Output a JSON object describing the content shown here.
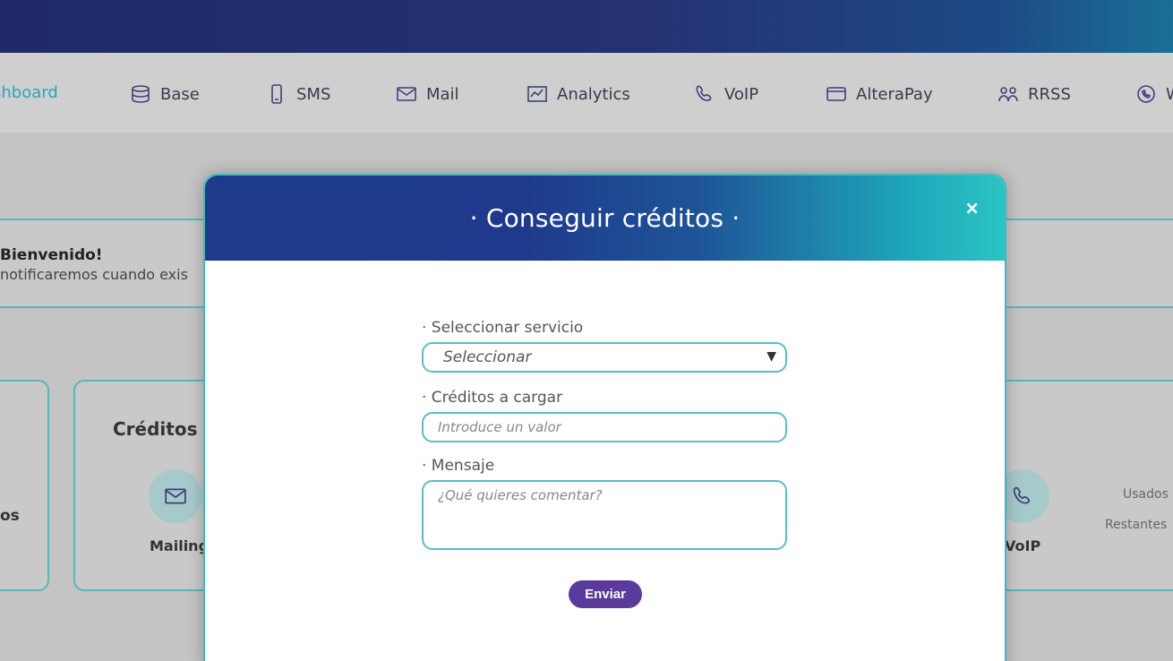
{
  "nav": {
    "items": [
      {
        "label": "shboard",
        "icon": "dashboard-icon",
        "active": true
      },
      {
        "label": "Base",
        "icon": "database-icon"
      },
      {
        "label": "SMS",
        "icon": "mobile-icon"
      },
      {
        "label": "Mail",
        "icon": "envelope-icon"
      },
      {
        "label": "Analytics",
        "icon": "chart-icon"
      },
      {
        "label": "VoIP",
        "icon": "phone-icon"
      },
      {
        "label": "AlteraPay",
        "icon": "card-icon"
      },
      {
        "label": "RRSS",
        "icon": "people-icon"
      },
      {
        "label": "W",
        "icon": "whatsapp-icon"
      }
    ]
  },
  "background": {
    "welcome_title": "Bienvenido!",
    "welcome_text": "notificaremos cuando exis",
    "cut_text": "os",
    "credits_title": "Créditos",
    "mailing_label": "Mailing",
    "voip_label": "VoIP",
    "used_label": "Usados",
    "remaining_label": "Restantes"
  },
  "modal": {
    "title": "· Conseguir créditos ·",
    "close_symbol": "×",
    "service_label": "· Seleccionar servicio",
    "service_value": "Seleccionar",
    "credits_label": "· Créditos a cargar",
    "credits_placeholder": "Introduce un valor",
    "message_label": "· Mensaje",
    "message_placeholder": "¿Qué quieres comentar?",
    "send_label": "Enviar"
  },
  "colors": {
    "accent": "#42b8c0",
    "button": "#5a3a9a",
    "header_start": "#1e3a8a",
    "header_end": "#2bc4c4"
  }
}
